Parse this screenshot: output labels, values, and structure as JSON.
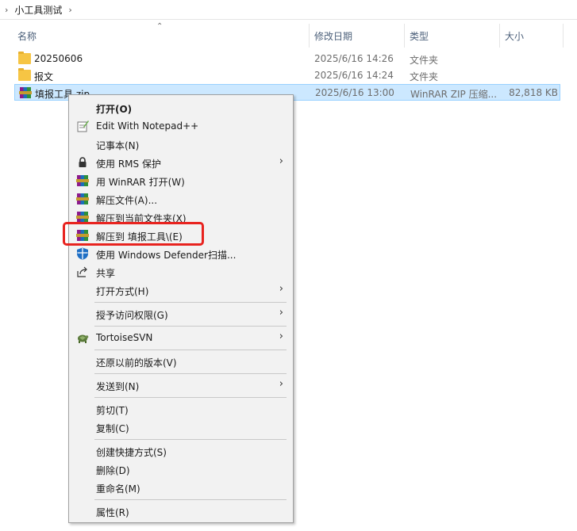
{
  "breadcrumb": {
    "path": "小工具测试"
  },
  "columns": {
    "name": "名称",
    "modified": "修改日期",
    "type": "类型",
    "size": "大小"
  },
  "files": [
    {
      "name": "20250606",
      "modified": "2025/6/16 14:26",
      "type": "文件夹",
      "size": "",
      "icon": "folder-icon"
    },
    {
      "name": "报文",
      "modified": "2025/6/16 14:24",
      "type": "文件夹",
      "size": "",
      "icon": "folder-icon"
    },
    {
      "name": "填报工具.zip",
      "modified": "2025/6/16 13:00",
      "type": "WinRAR ZIP 压缩...",
      "size": "82,818 KB",
      "icon": "winrar-icon",
      "selected": true
    }
  ],
  "context_menu": {
    "open": "打开(O)",
    "edit_notepad": "Edit With Notepad++",
    "notepad": "记事本(N)",
    "rms": "使用 RMS 保护",
    "winrar_open": "用 WinRAR 打开(W)",
    "extract_files": "解压文件(A)...",
    "extract_here": "解压到当前文件夹(X)",
    "extract_to": "解压到 填报工具\\(E)",
    "defender": "使用 Windows Defender扫描...",
    "share": "共享",
    "open_with": "打开方式(H)",
    "grant_access": "授予访问权限(G)",
    "tortoise": "TortoiseSVN",
    "restore": "还原以前的版本(V)",
    "send_to": "发送到(N)",
    "cut": "剪切(T)",
    "copy": "复制(C)",
    "shortcut": "创建快捷方式(S)",
    "delete": "删除(D)",
    "rename": "重命名(M)",
    "properties": "属性(R)"
  },
  "colors": {
    "selection": "#cce8ff",
    "highlight_box": "#e8231f",
    "menu_bg": "#f2f2f2"
  }
}
